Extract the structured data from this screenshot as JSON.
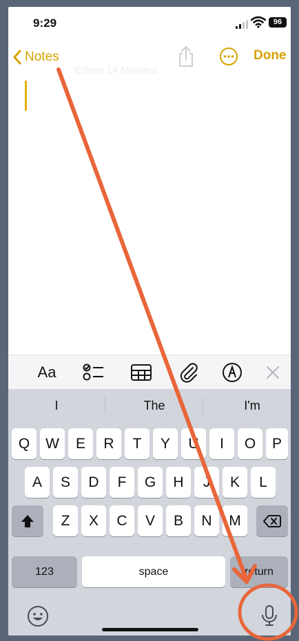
{
  "status_bar": {
    "time": "9:29",
    "battery": "96"
  },
  "nav": {
    "back_label": "Notes",
    "done_label": "Done",
    "faded_text": "Edited 14 Minutes"
  },
  "format_bar": {
    "text_style_label": "Aa"
  },
  "predictions": [
    "I",
    "The",
    "I'm"
  ],
  "keys": {
    "row1": [
      "Q",
      "W",
      "E",
      "R",
      "T",
      "Y",
      "U",
      "I",
      "O",
      "P"
    ],
    "row2": [
      "A",
      "S",
      "D",
      "F",
      "G",
      "H",
      "J",
      "K",
      "L"
    ],
    "row3": [
      "Z",
      "X",
      "C",
      "V",
      "B",
      "N",
      "M"
    ],
    "numbers_label": "123",
    "space_label": "space",
    "return_label": "return"
  },
  "colors": {
    "accent": "#d6a200",
    "annotation": "#e8663a",
    "keyboard_bg": "#d2d5dc"
  },
  "annotation": {
    "arrow": "arrow from Notes back button to microphone",
    "circle": "dictation microphone highlighted"
  }
}
